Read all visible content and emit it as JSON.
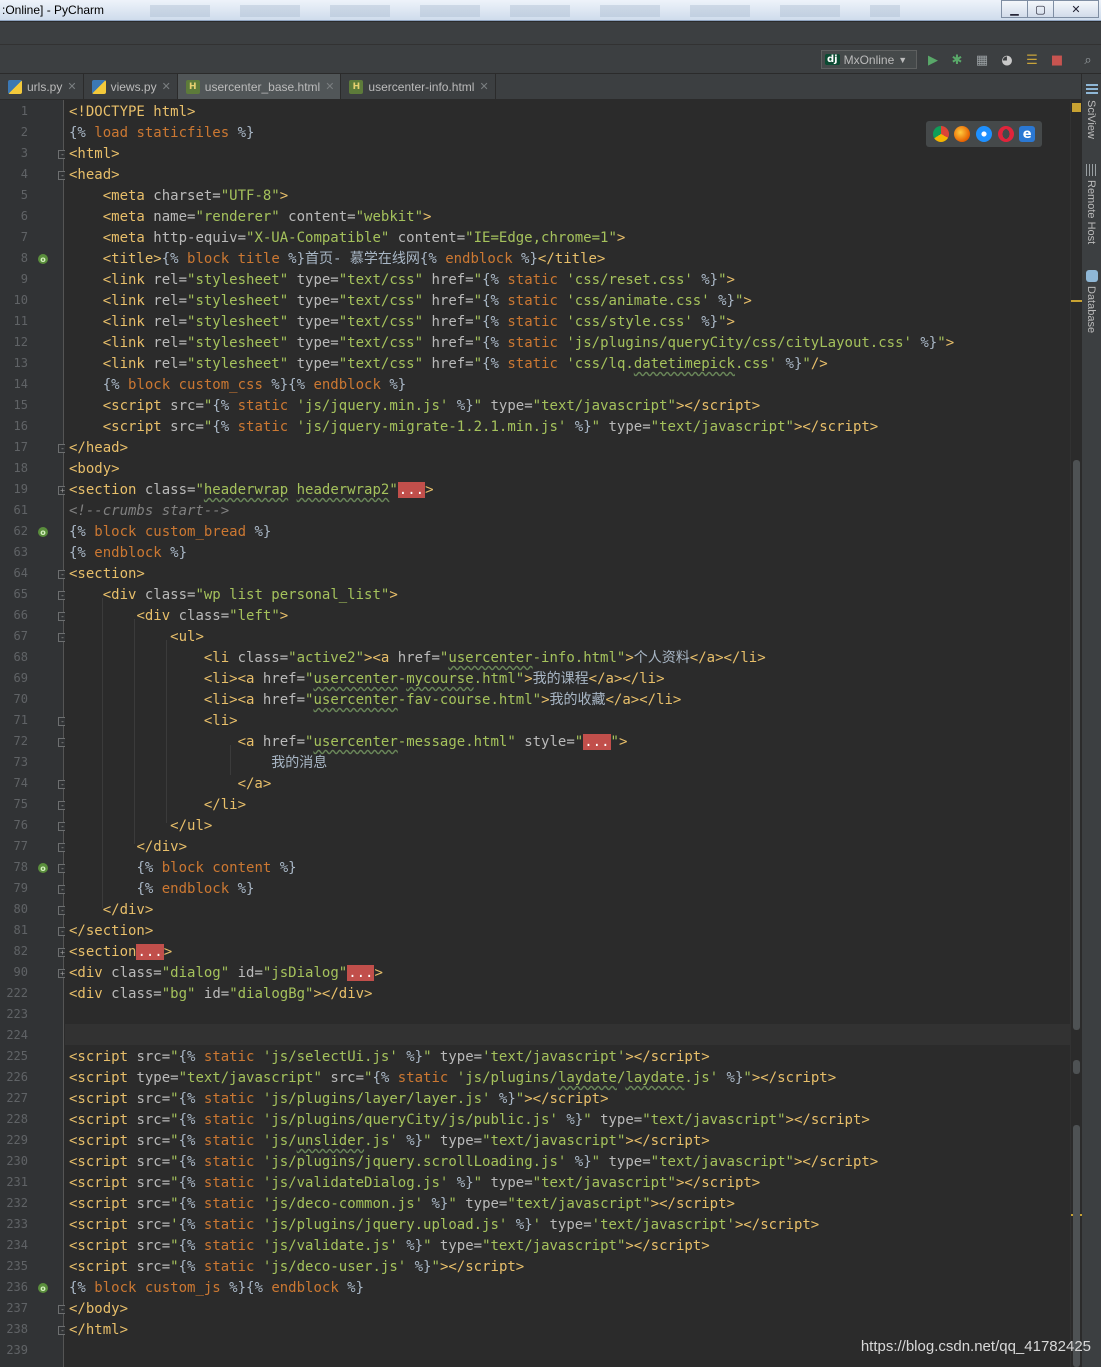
{
  "window": {
    "title": ":Online] - PyCharm",
    "min": "▁",
    "max": "▢",
    "close": "✕"
  },
  "toolbar": {
    "run_config": "MxOnline",
    "run_config_icon": "dj",
    "arrow": "▼"
  },
  "tabs": [
    {
      "label": "urls.py",
      "icon": "python-file-icon",
      "active": false
    },
    {
      "label": "views.py",
      "icon": "python-file-icon",
      "active": false
    },
    {
      "label": "usercenter_base.html",
      "icon": "html-file-icon",
      "active": true
    },
    {
      "label": "usercenter-info.html",
      "icon": "html-file-icon",
      "active": false
    }
  ],
  "tab_close": "✕",
  "right_tools": [
    "SciView",
    "Remote Host",
    "Database"
  ],
  "lines": [
    "1",
    "2",
    "3",
    "4",
    "5",
    "6",
    "7",
    "8",
    "9",
    "10",
    "11",
    "12",
    "13",
    "14",
    "15",
    "16",
    "17",
    "18",
    "19",
    "61",
    "62",
    "63",
    "64",
    "65",
    "66",
    "67",
    "68",
    "69",
    "70",
    "71",
    "72",
    "73",
    "74",
    "75",
    "76",
    "77",
    "78",
    "79",
    "80",
    "81",
    "82",
    "90",
    "222",
    "223",
    "224",
    "225",
    "226",
    "227",
    "228",
    "229",
    "230",
    "231",
    "232",
    "233",
    "234",
    "235",
    "236",
    "237",
    "238",
    "239"
  ],
  "watermark": "https://blog.csdn.net/qq_41782425",
  "colors": {
    "tag": "#e8bf6a",
    "attr": "#bababa",
    "value": "#a5c25c",
    "keyword": "#cc7832",
    "text": "#a9b7c6",
    "fold": "#c14f4b"
  }
}
